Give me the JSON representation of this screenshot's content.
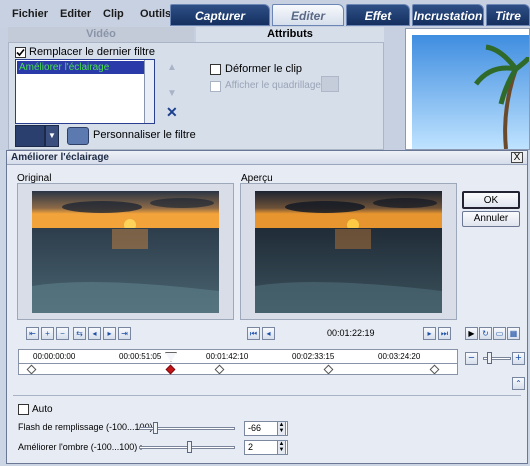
{
  "app": {
    "menu": [
      "Fichier",
      "Editer",
      "Clip",
      "Outils"
    ],
    "tabs": [
      "Capturer",
      "Editer",
      "Effet",
      "Incrustation",
      "Titre"
    ],
    "subtabs": [
      "Vidéo",
      "Attributs"
    ],
    "replace_filter_label": "Remplacer le dernier filtre",
    "filter_list": [
      "Améliorer l'éclairage"
    ],
    "distort_clip_label": "Déformer le clip",
    "show_grid_label": "Afficher le quadrillage",
    "customize_filter_label": "Personnaliser le filtre"
  },
  "dialog": {
    "title": "Améliorer l'éclairage",
    "close_glyph": "X",
    "original_label": "Original",
    "preview_label": "Aperçu",
    "ok_label": "OK",
    "cancel_label": "Annuler",
    "timecode": "00:01:22:19",
    "ruler_labels": [
      "00:00:00:00",
      "00:00:51:05",
      "00:01:42:10",
      "00:02:33:15",
      "00:03:24:20"
    ],
    "auto_label": "Auto",
    "fill_flash": {
      "label": "Flash de remplissage (-100...100) :",
      "value": "-66"
    },
    "shadow": {
      "label": "Améliorer l'ombre (-100...100) :",
      "value": "2"
    }
  }
}
